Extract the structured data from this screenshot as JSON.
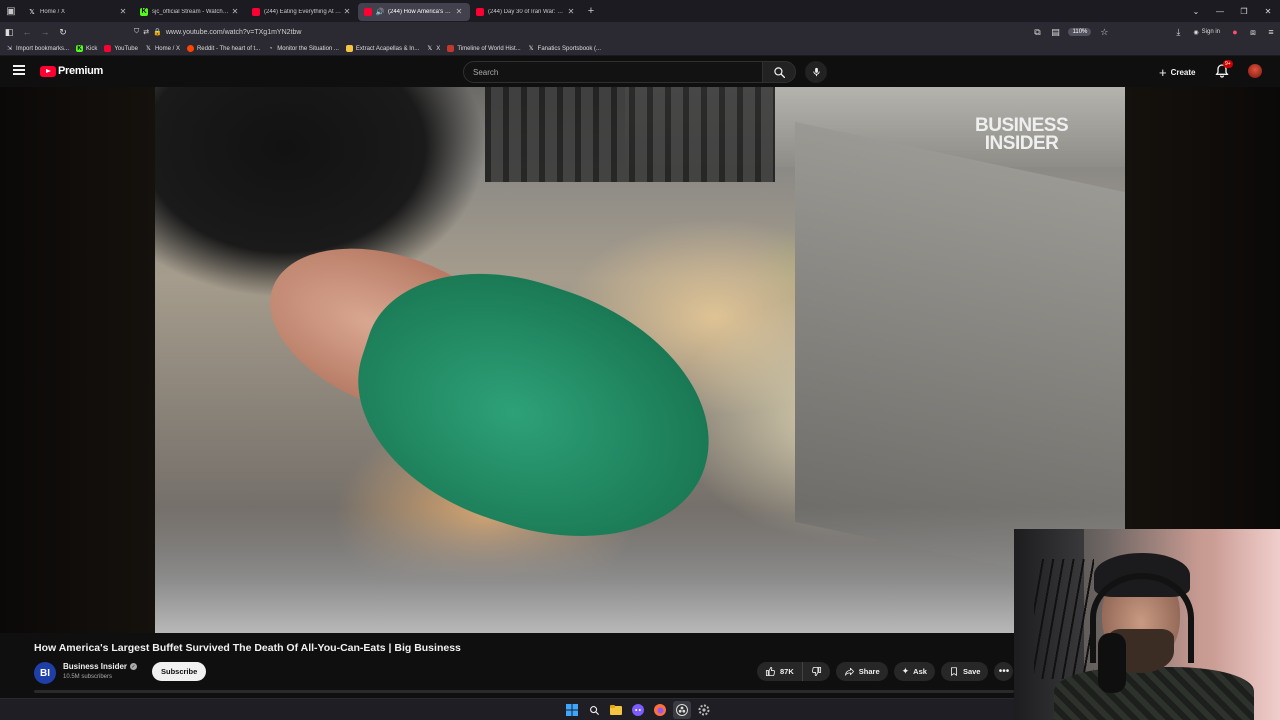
{
  "browser": {
    "tabs": [
      {
        "label": "Home / X",
        "icon": "x-logo-icon",
        "color": "#ffffff",
        "active": false
      },
      {
        "label": "sjc_official Stream - Watch Live",
        "icon": "kick-icon",
        "color": "#53fc18",
        "active": false
      },
      {
        "label": "(244) Eating Everything At Ame",
        "icon": "youtube-icon",
        "color": "#ff0033",
        "active": false
      },
      {
        "label": "(244) How America's Large",
        "icon": "youtube-icon",
        "color": "#ff0033",
        "active": true
      },
      {
        "label": "(244) Day 30 of Iran War: What",
        "icon": "youtube-icon",
        "color": "#ff0033",
        "active": false
      }
    ],
    "url": "www.youtube.com/watch?v=TXg1mYN2tbw",
    "zoom": "110%",
    "signin_label": "Sign in",
    "bookmarks": [
      {
        "label": "Import bookmarks...",
        "icon": "import-icon"
      },
      {
        "label": "Kick",
        "icon": "kick-icon"
      },
      {
        "label": "YouTube",
        "icon": "youtube-icon"
      },
      {
        "label": "Home / X",
        "icon": "x-logo-icon"
      },
      {
        "label": "Reddit - The heart of t...",
        "icon": "reddit-icon"
      },
      {
        "label": "Monitor the Situation ...",
        "icon": "monitor-icon"
      },
      {
        "label": "Extract Acapellas & In...",
        "icon": "acapella-icon"
      },
      {
        "label": "X",
        "icon": "x-logo-icon"
      },
      {
        "label": "Timeline of World Hist...",
        "icon": "timeline-icon"
      },
      {
        "label": "Fanatics Sportsbook (...",
        "icon": "x-logo-icon"
      }
    ]
  },
  "youtube": {
    "logo_text": "Premium",
    "search_placeholder": "Search",
    "create_label": "Create",
    "notification_count": "9+",
    "brand_color": "#ff0033"
  },
  "video": {
    "watermark_line1": "BUSINESS",
    "watermark_line2": "INSIDER",
    "title": "How America's Largest Buffet Survived The Death Of All-You-Can-Eats | Big Business",
    "channel_initials": "BI",
    "channel_name": "Business Insider",
    "subscribers": "10.5M subscribers",
    "subscribe_label": "Subscribe",
    "likes": "87K",
    "share_label": "Share",
    "ask_label": "Ask",
    "save_label": "Save"
  },
  "taskbar": {
    "icons": [
      "windows-start-icon",
      "search-icon",
      "file-explorer-icon",
      "discord-icon",
      "firefox-icon",
      "obs-icon",
      "settings-icon"
    ]
  }
}
